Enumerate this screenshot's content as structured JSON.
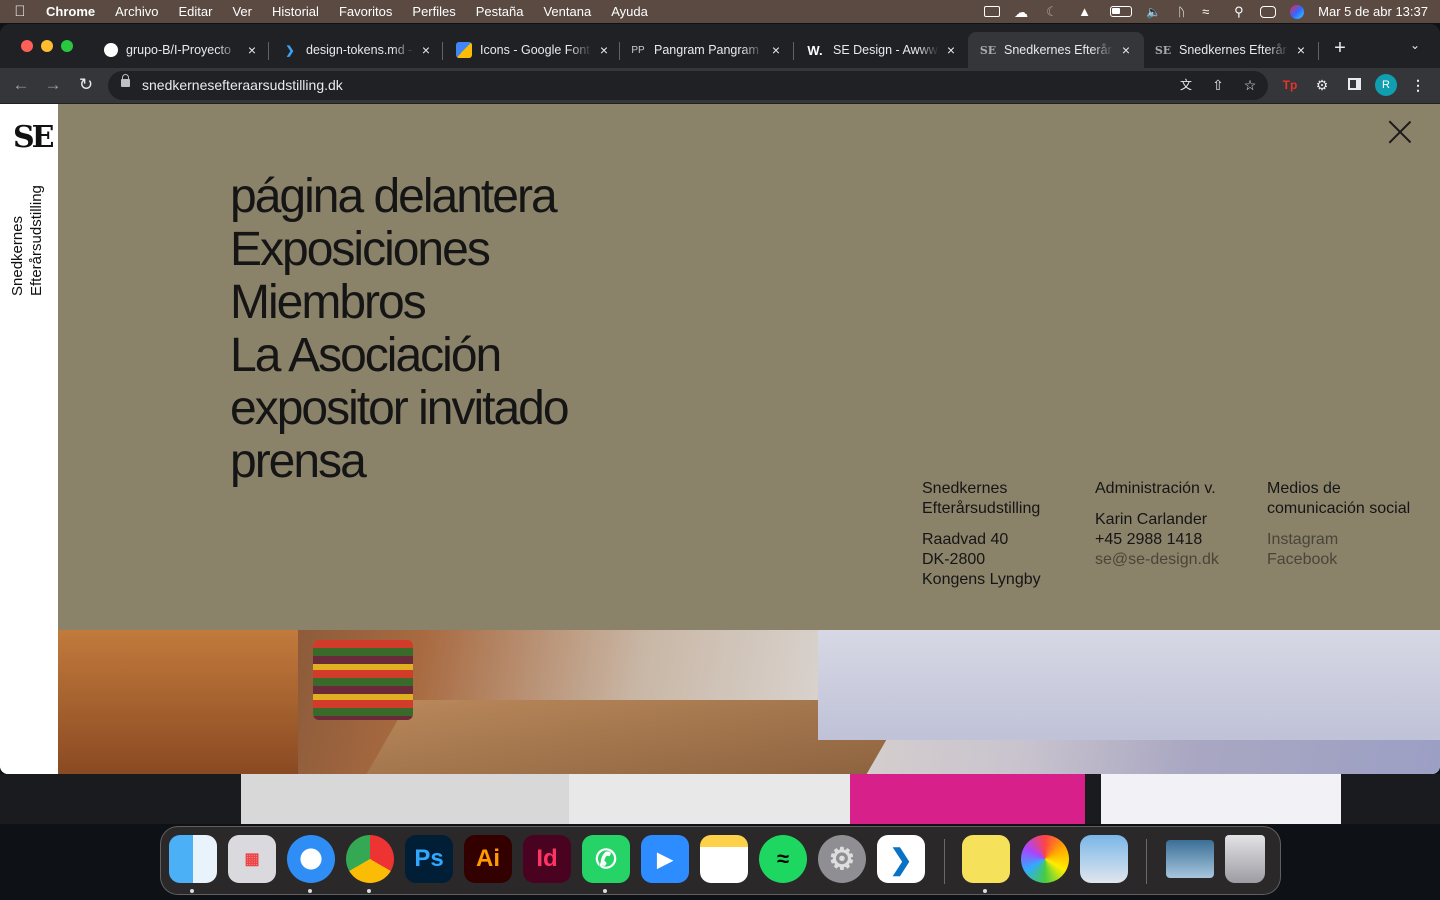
{
  "menubar": {
    "app_name": "Chrome",
    "items": [
      "Archivo",
      "Editar",
      "Ver",
      "Historial",
      "Favoritos",
      "Perfiles",
      "Pestaña",
      "Ventana",
      "Ayuda"
    ],
    "datetime": "Mar 5 de abr  13:37"
  },
  "tabs": [
    {
      "title": "grupo-B/I-Proyecto",
      "icon": "github-icon"
    },
    {
      "title": "design-tokens.md -",
      "icon": "vscode-icon"
    },
    {
      "title": "Icons - Google Font",
      "icon": "google-fonts-icon"
    },
    {
      "title": "Pangram Pangram F",
      "icon": "pangram-icon",
      "icon_text": "PP"
    },
    {
      "title": "SE Design - Awwwa",
      "icon": "awwwards-icon",
      "icon_text": "W."
    },
    {
      "title": "Snedkernes Efterår",
      "icon": "se-icon",
      "icon_text": "SE",
      "active": true
    },
    {
      "title": "Snedkernes Efterår",
      "icon": "se-icon",
      "icon_text": "SE"
    }
  ],
  "address_bar": {
    "url": "snedkernesefteraarsudstilling.dk"
  },
  "profile_initial": "R",
  "site": {
    "logo_text": "SE",
    "vertical_name_line1": "Snedkernes",
    "vertical_name_line2": "Efterårsudstilling",
    "nav": [
      "página delantera",
      "Exposiciones",
      "Miembros",
      "La Asociación",
      "expositor invitado",
      "prensa"
    ],
    "info": {
      "col1": {
        "name_line1": "Snedkernes",
        "name_line2": "Efterårsudstilling",
        "address_line1": "Raadvad 40",
        "address_line2": "DK-2800",
        "address_line3": "Kongens Lyngby"
      },
      "col2": {
        "heading": "Administración v.",
        "contact_name": "Karin Carlander",
        "phone": "+45 2988 1418",
        "email": "se@se-design.dk"
      },
      "col3": {
        "heading_line1": "Medios de",
        "heading_line2": "comunicación social",
        "link1": "Instagram",
        "link2": "Facebook"
      }
    },
    "colors": {
      "overlay": "#8b826a",
      "text": "#151515"
    }
  },
  "dock": [
    {
      "name": "finder",
      "icon": "finder-icon"
    },
    {
      "name": "launchpad",
      "icon": "launchpad-icon"
    },
    {
      "name": "safari",
      "icon": "safari-icon"
    },
    {
      "name": "chrome",
      "icon": "chrome-icon"
    },
    {
      "name": "photoshop",
      "icon": "photoshop-icon",
      "label": "Ps"
    },
    {
      "name": "illustrator",
      "icon": "illustrator-icon",
      "label": "Ai"
    },
    {
      "name": "indesign",
      "icon": "indesign-icon",
      "label": "Id"
    },
    {
      "name": "whatsapp",
      "icon": "whatsapp-icon"
    },
    {
      "name": "zoom",
      "icon": "zoom-icon"
    },
    {
      "name": "notes",
      "icon": "notes-icon"
    },
    {
      "name": "spotify",
      "icon": "spotify-icon"
    },
    {
      "name": "system-preferences",
      "icon": "gear-icon"
    },
    {
      "name": "vscode",
      "icon": "vscode-icon"
    },
    {
      "name": "stickies",
      "icon": "stickies-icon"
    },
    {
      "name": "photos",
      "icon": "photos-icon"
    },
    {
      "name": "preview",
      "icon": "preview-icon"
    },
    {
      "name": "downloads-stack",
      "icon": "stack-icon"
    },
    {
      "name": "trash",
      "icon": "trash-icon"
    }
  ]
}
